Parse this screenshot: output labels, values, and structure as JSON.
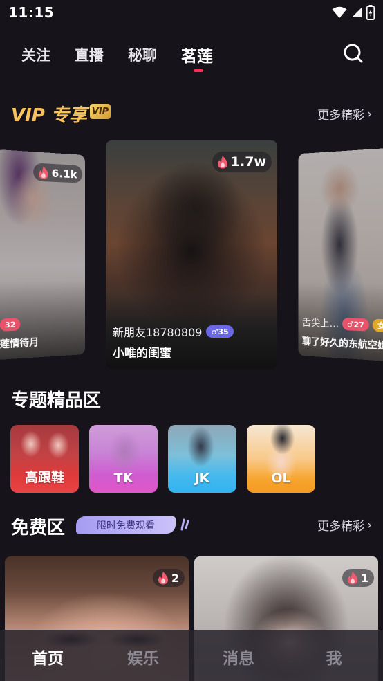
{
  "status_bar": {
    "time": "11:15"
  },
  "top_tabs": [
    {
      "label": "关注"
    },
    {
      "label": "直播"
    },
    {
      "label": "秘聊"
    },
    {
      "label": "茗莲",
      "active": true
    }
  ],
  "vip_section": {
    "title": "VIP 专享",
    "badge": "VIP",
    "more": "更多精彩"
  },
  "vip_cards": {
    "left": {
      "heat": "6.1k",
      "age": "32",
      "caption": "莲情待月"
    },
    "center": {
      "heat": "1.7w",
      "username": "新朋友18780809",
      "age": "35",
      "caption": "小唯的闺蜜"
    },
    "right": {
      "heat": "",
      "username": "舌尖上…",
      "age": "27",
      "badge2": "女",
      "caption": "聊了好久的东航空姐"
    }
  },
  "topic_section": {
    "title": "专题精品区",
    "items": [
      {
        "label": "高跟鞋"
      },
      {
        "label": "TK"
      },
      {
        "label": "JK"
      },
      {
        "label": "OL"
      }
    ]
  },
  "free_section": {
    "title": "免费区",
    "tag": "限时免费观看",
    "more": "更多精彩",
    "cards": [
      {
        "heat": "2"
      },
      {
        "heat": "1"
      }
    ]
  },
  "bottom_nav": [
    {
      "label": "首页",
      "active": true
    },
    {
      "label": "娱乐"
    },
    {
      "label": "消息"
    },
    {
      "label": "我"
    }
  ],
  "colors": {
    "accent": "#ff2d55",
    "vip_gold": "#f7c35a",
    "background": "#16131b"
  }
}
